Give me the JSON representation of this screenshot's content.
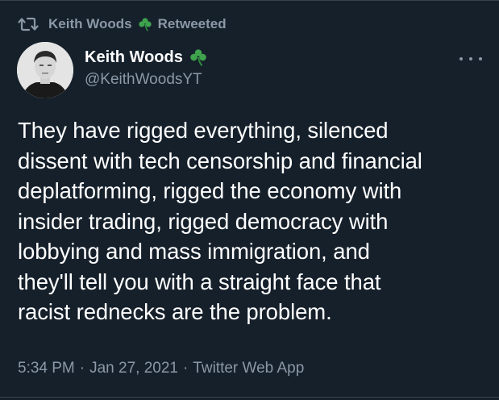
{
  "retweet_banner": {
    "icon": "retweet-icon",
    "user_name": "Keith Woods",
    "emoji": "shamrock-icon",
    "label": "Retweeted"
  },
  "author": {
    "display_name": "Keith Woods",
    "emoji": "shamrock-icon",
    "handle": "@KeithWoodsYT"
  },
  "more_menu": {
    "icon": "more-options-icon"
  },
  "tweet": {
    "lines": [
      "They have rigged everything, silenced",
      "dissent with tech censorship and financial",
      "deplatforming, rigged the economy with",
      "insider trading, rigged democracy with",
      "lobbying and mass immigration, and",
      "they'll tell you with a straight face that",
      "racist rednecks are the problem."
    ]
  },
  "meta": {
    "time": "5:34 PM",
    "separator": "·",
    "date": "Jan 27, 2021",
    "source": "Twitter Web App"
  },
  "colors": {
    "background": "#15202b",
    "text_primary": "#ffffff",
    "text_secondary": "#8b98a5",
    "shamrock": "#3fa34d",
    "divider": "#38444d"
  }
}
